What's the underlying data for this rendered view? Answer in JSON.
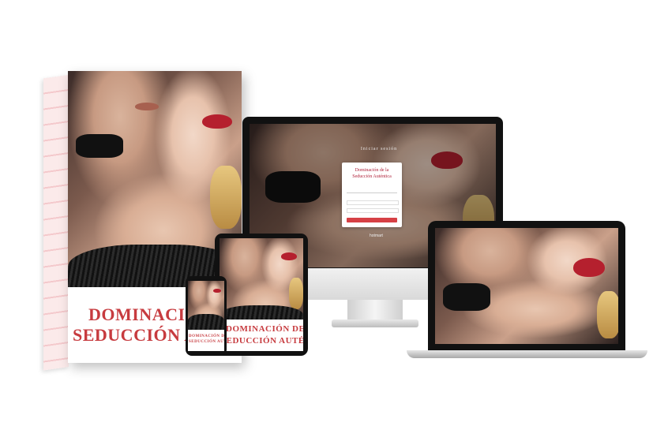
{
  "box": {
    "title_line1": "DOMINACIÓN",
    "title_line2": "SEDUCCIÓN AU"
  },
  "tablet": {
    "title_line1": "DOMINACIÓN DE LA",
    "title_line2": "SEDUCCIÓN AUTÉNTICA"
  },
  "phone": {
    "title_line1": "DOMINACIÓN DE LA",
    "title_line2": "SEDUCCIÓN AUTÉNTICA"
  },
  "monitor": {
    "heading": "Iniciar sesión",
    "card_title_line1": "Dominación de la",
    "card_title_line2": "Seducción Auténtica",
    "logo_text": "hotmart"
  },
  "colors": {
    "title_red": "#c73b3f",
    "button_red": "#d64045",
    "device_black": "#111111"
  }
}
